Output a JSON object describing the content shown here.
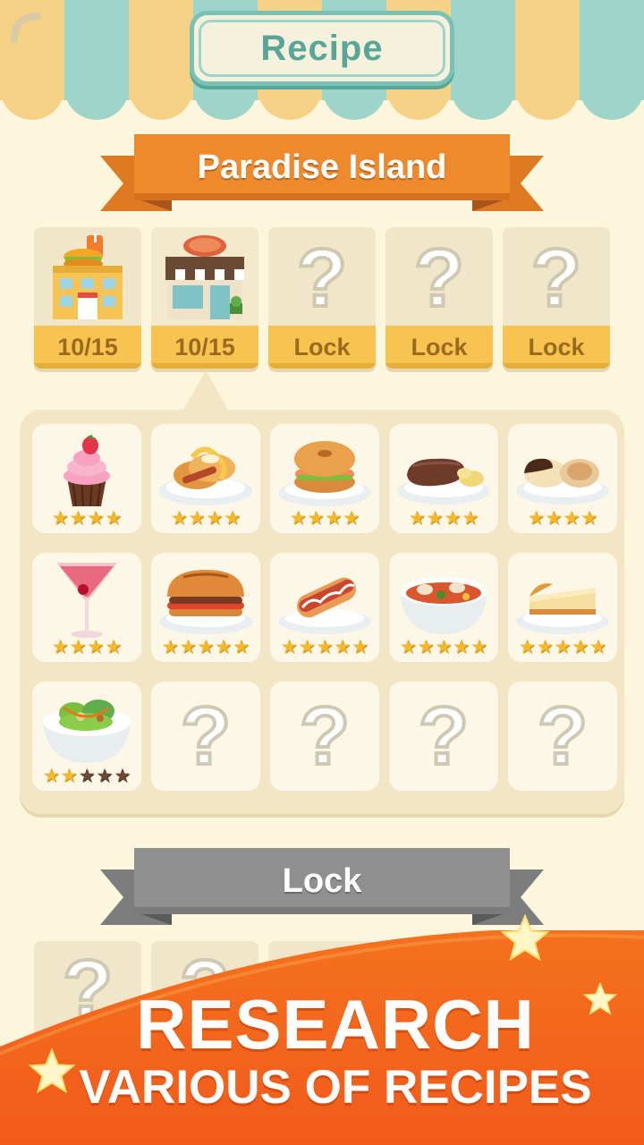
{
  "header": {
    "title": "Recipe"
  },
  "region_banner": {
    "label": "Paradise Island"
  },
  "restaurants": [
    {
      "label": "10/15",
      "icon": "fast-food-restaurant-icon",
      "unlocked": true
    },
    {
      "label": "10/15",
      "icon": "steak-house-restaurant-icon",
      "unlocked": true
    },
    {
      "label": "Lock",
      "icon": "question-mark-icon",
      "unlocked": false
    },
    {
      "label": "Lock",
      "icon": "question-mark-icon",
      "unlocked": false
    },
    {
      "label": "Lock",
      "icon": "question-mark-icon",
      "unlocked": false
    }
  ],
  "recipes": [
    {
      "dish": "cupcake-icon",
      "stars": 4,
      "max_stars": 4
    },
    {
      "dish": "pancakes-icon",
      "stars": 4,
      "max_stars": 4
    },
    {
      "dish": "bagel-sandwich-icon",
      "stars": 4,
      "max_stars": 4
    },
    {
      "dish": "steak-potato-icon",
      "stars": 4,
      "max_stars": 4
    },
    {
      "dish": "macarons-icon",
      "stars": 4,
      "max_stars": 4
    },
    {
      "dish": "cocktail-icon",
      "stars": 4,
      "max_stars": 4
    },
    {
      "dish": "burger-icon",
      "stars": 5,
      "max_stars": 5
    },
    {
      "dish": "hot-dog-icon",
      "stars": 5,
      "max_stars": 5
    },
    {
      "dish": "seafood-soup-icon",
      "stars": 5,
      "max_stars": 5
    },
    {
      "dish": "cheesecake-icon",
      "stars": 5,
      "max_stars": 5
    },
    {
      "dish": "salad-icon",
      "stars": 2,
      "max_stars": 5
    },
    {
      "dish": "question-mark-icon",
      "locked": true
    },
    {
      "dish": "question-mark-icon",
      "locked": true
    },
    {
      "dish": "question-mark-icon",
      "locked": true
    },
    {
      "dish": "question-mark-icon",
      "locked": true
    }
  ],
  "locked_banner": {
    "label": "Lock"
  },
  "promo": {
    "line1": "RESEARCH",
    "line2": "VARIOUS OF RECIPES"
  },
  "qmark": "?",
  "colors": {
    "background": "#fbf6dc",
    "awning_yellow": "#f6d286",
    "awning_teal": "#9ed4c9",
    "ribbon_orange": "#ee8a2c",
    "ribbon_gray": "#8f8f8f",
    "card_label": "#f7c451",
    "promo_orange": "#f26b1d",
    "star_gold": "#f5b82a"
  }
}
